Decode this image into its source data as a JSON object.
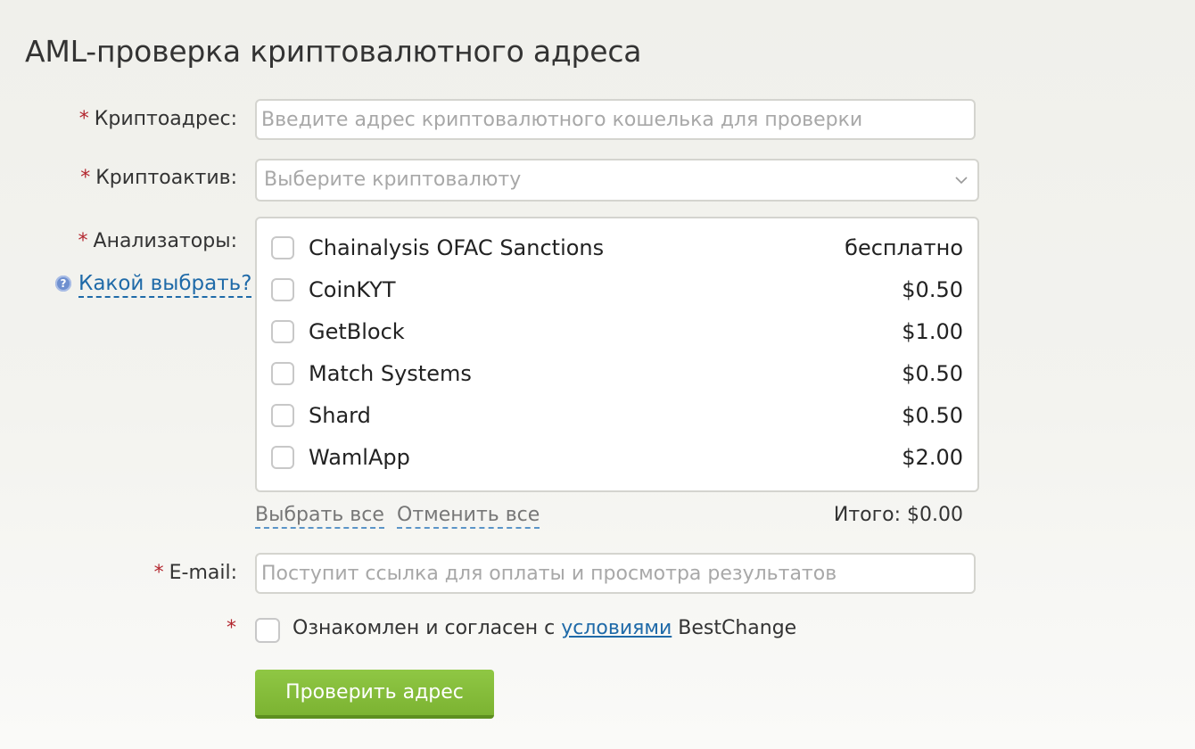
{
  "page": {
    "title": "AML-проверка криптовалютного адреса"
  },
  "form": {
    "required_mark": "*",
    "address": {
      "label": "Криптоадрес:",
      "placeholder": "Введите адрес криптовалютного кошелька для проверки",
      "value": ""
    },
    "asset": {
      "label": "Криптоактив:",
      "selected": "Выберите криптовалюту",
      "icon": "chevron-down-icon"
    },
    "analyzers": {
      "label": "Анализаторы:",
      "help_icon": "question-icon",
      "help_icon_glyph": "?",
      "help_link": "Какой выбрать?",
      "items": [
        {
          "name": "Chainalysis OFAC Sanctions",
          "price": "бесплатно",
          "checked": false
        },
        {
          "name": "CoinKYT",
          "price": "$0.50",
          "checked": false
        },
        {
          "name": "GetBlock",
          "price": "$1.00",
          "checked": false
        },
        {
          "name": "Match Systems",
          "price": "$0.50",
          "checked": false
        },
        {
          "name": "Shard",
          "price": "$0.50",
          "checked": false
        },
        {
          "name": "WamlApp",
          "price": "$2.00",
          "checked": false
        }
      ],
      "select_all": "Выбрать все",
      "cancel_all": "Отменить все",
      "total": "Итого: $0.00"
    },
    "email": {
      "label": "E-mail:",
      "placeholder": "Поступит ссылка для оплаты и просмотра результатов",
      "value": ""
    },
    "agreement": {
      "prefix": "Ознакомлен и согласен с ",
      "link": "условиями",
      "suffix": " BestChange",
      "checked": false
    },
    "submit_label": "Проверить адрес"
  },
  "colors": {
    "accent_green": "#8fc744",
    "link_blue": "#1f6aa8",
    "required_red": "#b3262e"
  }
}
